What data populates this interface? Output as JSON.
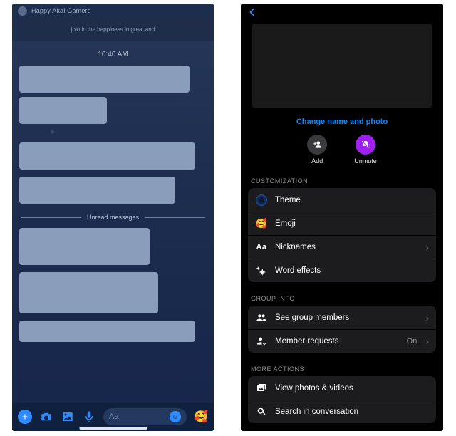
{
  "left": {
    "group_name": "Happy Akai Gamers",
    "top_hint": "join in the happiness in great and",
    "timestamp": "10:40 AM",
    "unread_label": "Unread messages",
    "composer_placeholder": "Aa"
  },
  "right": {
    "change_link": "Change name and photo",
    "actions": {
      "add": "Add",
      "unmute": "Unmute"
    },
    "sections": {
      "customization": {
        "header": "CUSTOMIZATION",
        "theme": "Theme",
        "emoji": "Emoji",
        "nicknames": "Nicknames",
        "word_effects": "Word effects"
      },
      "group_info": {
        "header": "GROUP INFO",
        "members": "See group members",
        "requests": "Member requests",
        "requests_value": "On"
      },
      "more_actions": {
        "header": "MORE ACTIONS",
        "photos": "View photos & videos",
        "search": "Search in conversation"
      }
    }
  }
}
